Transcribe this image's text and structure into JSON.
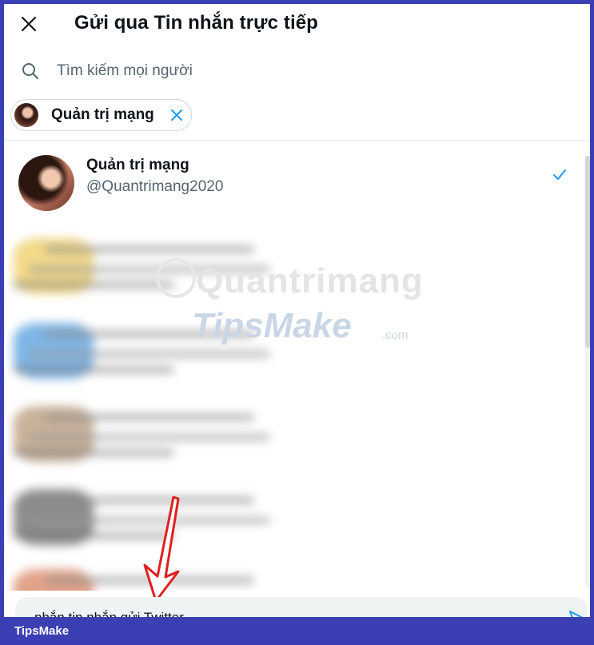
{
  "dialog": {
    "title": "Gửi qua Tin nhắn trực tiếp",
    "close_icon": "close-icon"
  },
  "search": {
    "placeholder": "Tìm kiếm mọi người",
    "value": "",
    "icon": "search-icon"
  },
  "selected_chip": {
    "label": "Quản trị mạng",
    "remove_icon": "close-icon",
    "remove_color": "#1d9bf0"
  },
  "results": [
    {
      "name": "Quản trị mạng",
      "handle": "@Quantrimang2020",
      "selected": true,
      "check_icon": "check-icon"
    }
  ],
  "composer": {
    "text": "nhắn tin nhắn gửi Twitter",
    "send_icon": "send-icon"
  },
  "watermark": {
    "top": "Quantrimang",
    "bottom": "TipsMake",
    "suffix": ".com"
  },
  "footer": {
    "brand": "TipsMake"
  },
  "colors": {
    "accent": "#1d9bf0",
    "frame": "#3b3fb3",
    "text": "#0f1419",
    "secondary": "#536471",
    "arrow": "#e02020"
  }
}
